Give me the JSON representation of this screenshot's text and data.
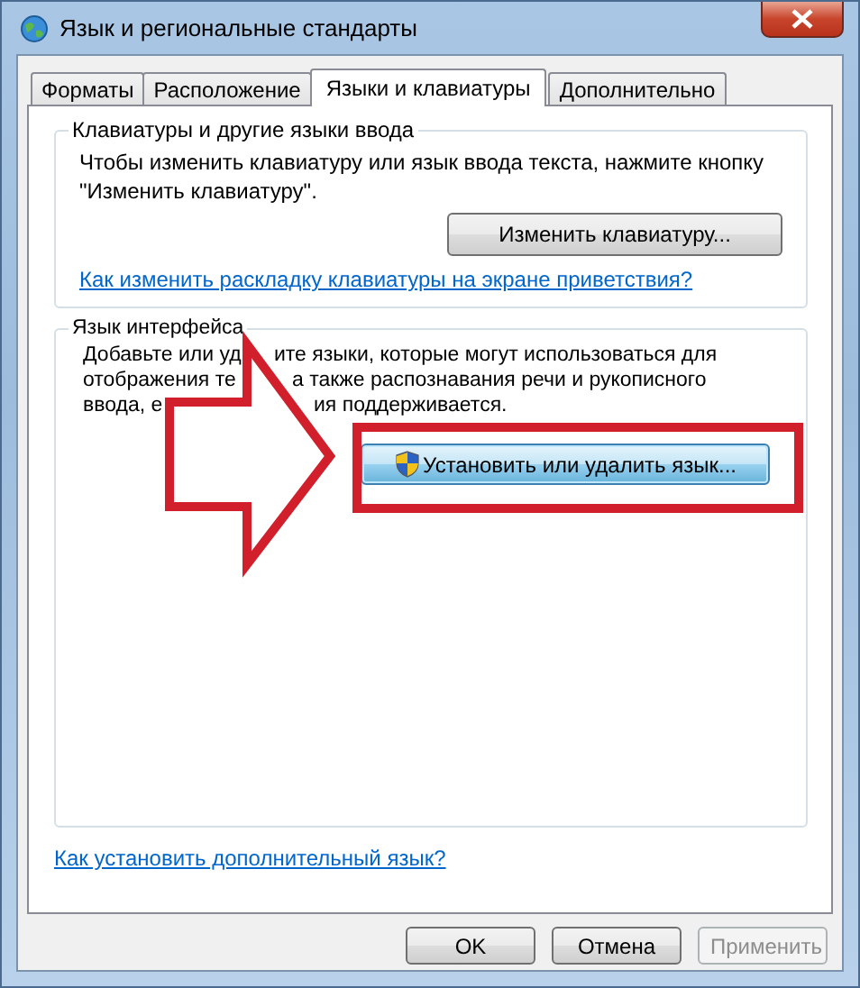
{
  "window": {
    "title": "Язык и региональные стандарты"
  },
  "tabs": [
    {
      "label": "Форматы",
      "selected": false
    },
    {
      "label": "Расположение",
      "selected": false
    },
    {
      "label": "Языки и клавиатуры",
      "selected": true
    },
    {
      "label": "Дополнительно",
      "selected": false
    }
  ],
  "keyboards_group": {
    "title": "Клавиатуры и другие языки ввода",
    "text": "Чтобы изменить клавиатуру или язык ввода текста, нажмите кнопку \"Изменить клавиатуру\".",
    "button": {
      "label": "Изменить клавиатуру...",
      "focused": false
    },
    "link": "Как изменить раскладку клавиатуры на экране приветствия?"
  },
  "interface_group": {
    "title": "Язык интерфейса",
    "text_lines": [
      [
        "Добавьте или уд",
        "ите языки, которые могут использоваться для"
      ],
      [
        "отображения те",
        "а также распознавания речи и рукописного"
      ],
      [
        "ввода, е",
        "ия поддерживается."
      ]
    ],
    "button": {
      "label": "Установить или удалить язык...",
      "focused": true,
      "shield": true
    }
  },
  "link": "Как установить дополнительный язык?",
  "buttons": [
    {
      "label": "OK",
      "disabled": false
    },
    {
      "label": "Отмена",
      "disabled": false
    },
    {
      "label": "Применить",
      "disabled": true
    }
  ]
}
